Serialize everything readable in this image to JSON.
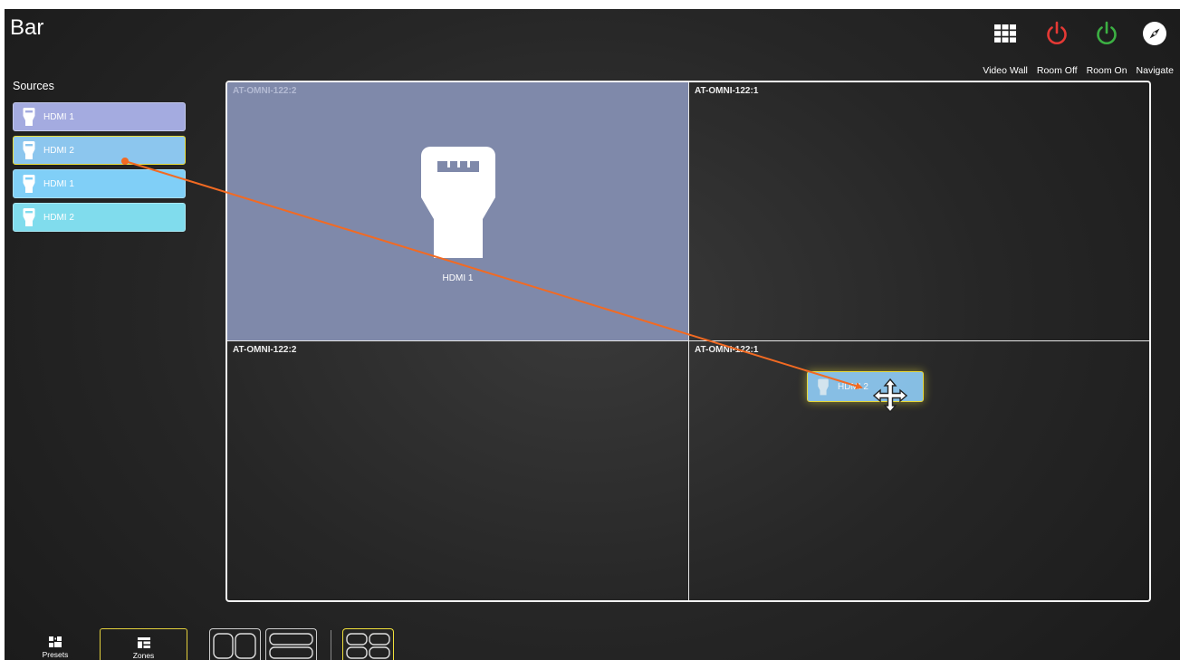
{
  "app": {
    "title": "Bar"
  },
  "topbar": [
    {
      "id": "video-wall",
      "label": "Video Wall",
      "icon": "grid-icon",
      "color": "#ffffff"
    },
    {
      "id": "room-off",
      "label": "Room Off",
      "icon": "power-icon",
      "color": "#e53935"
    },
    {
      "id": "room-on",
      "label": "Room On",
      "icon": "power-icon",
      "color": "#3cb043"
    },
    {
      "id": "navigate",
      "label": "Navigate",
      "icon": "compass-icon",
      "color": "#ffffff"
    }
  ],
  "sources": {
    "label": "Sources",
    "items": [
      {
        "name": "HDMI 1",
        "color": "#a4abe0",
        "selected": false
      },
      {
        "name": "HDMI 2",
        "color": "#8cc6ee",
        "selected": true
      },
      {
        "name": "HDMI 1",
        "color": "#80cff7",
        "selected": false
      },
      {
        "name": "HDMI 2",
        "color": "#80dced",
        "selected": false
      }
    ]
  },
  "zones": [
    {
      "label": "AT-OMNI-122:2",
      "source": "HDMI 1"
    },
    {
      "label": "AT-OMNI-122:1",
      "source": ""
    },
    {
      "label": "AT-OMNI-122:2",
      "source": ""
    },
    {
      "label": "AT-OMNI-122:1",
      "source": ""
    }
  ],
  "drag": {
    "source": "HDMI 2"
  },
  "bottom": {
    "presets_label": "Presets",
    "zones_label": "Zones",
    "accent": "#f0e03a"
  }
}
